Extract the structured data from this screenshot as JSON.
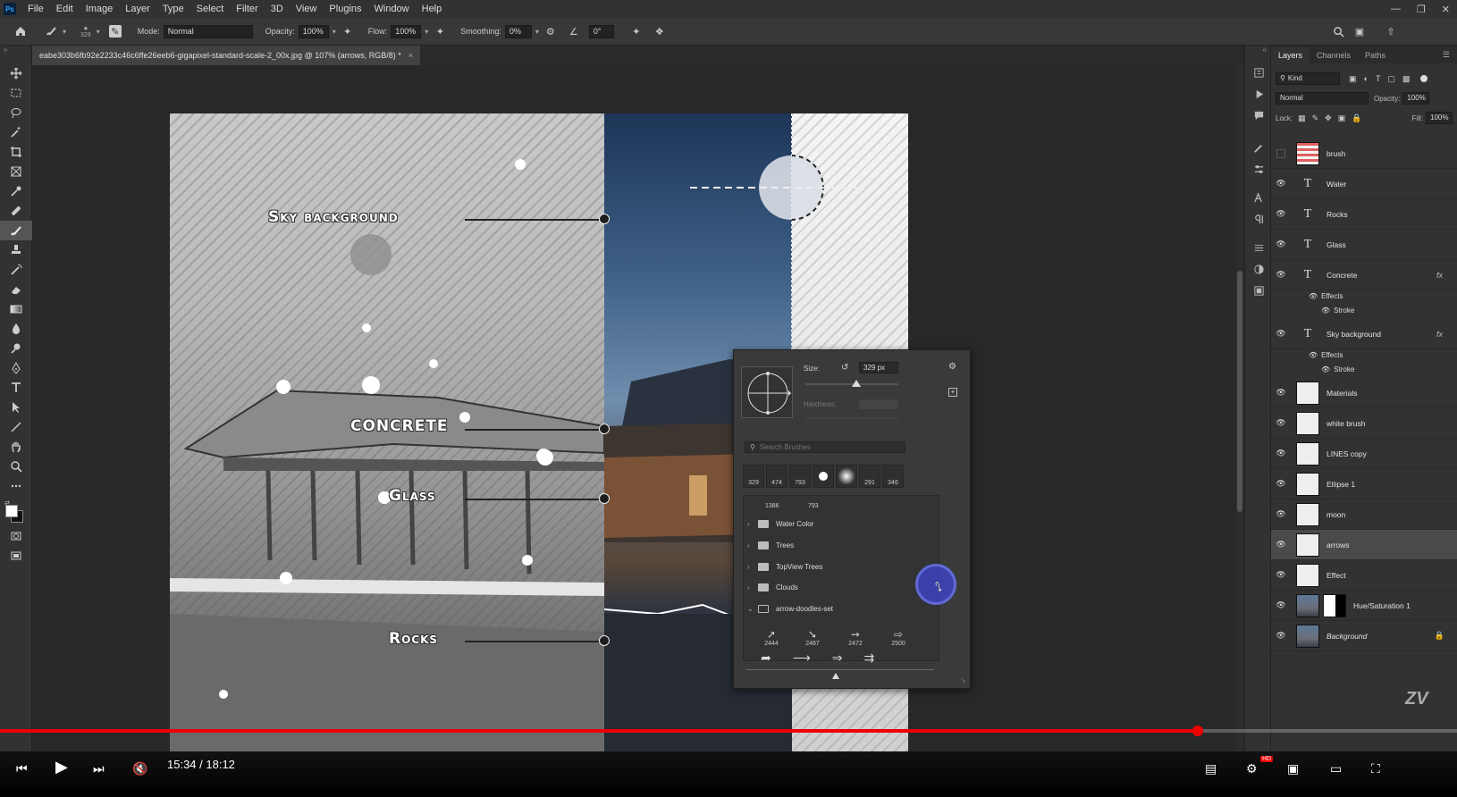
{
  "app": {
    "logo": "Ps"
  },
  "menu": [
    "File",
    "Edit",
    "Image",
    "Layer",
    "Type",
    "Select",
    "Filter",
    "3D",
    "View",
    "Plugins",
    "Window",
    "Help"
  ],
  "options_bar": {
    "brush_size": "329",
    "mode_label": "Mode:",
    "mode_value": "Normal",
    "opacity_label": "Opacity:",
    "opacity_value": "100%",
    "flow_label": "Flow:",
    "flow_value": "100%",
    "smoothing_label": "Smoothing:",
    "smoothing_value": "0%",
    "angle_value": "0°"
  },
  "document_tab": {
    "title": "eabe303b6fb92e2233c46c6ffe26eeb6-gigapixel-standard-scale-2_00x.jpg @ 107% (arrows, RGB/8) *",
    "close": "×"
  },
  "artwork": {
    "labels": [
      "Sky background",
      "Concrete",
      "Glass",
      "Rocks"
    ]
  },
  "brush_panel": {
    "size_label": "Size:",
    "size_value": "329 px",
    "size_slider_fraction": 0.55,
    "hardness_label": "Hardness:",
    "search_placeholder": "Search Brushes",
    "recent_presets": [
      "329",
      "474",
      "793",
      "",
      "",
      "291",
      "346"
    ],
    "partial_row": [
      "1386",
      "793"
    ],
    "folders": [
      {
        "name": "Water Color",
        "expanded": false
      },
      {
        "name": "Trees",
        "expanded": false
      },
      {
        "name": "TopView Trees",
        "expanded": false
      },
      {
        "name": "Clouds",
        "expanded": false
      },
      {
        "name": "arrow-doodles-set",
        "expanded": true
      }
    ],
    "arrow_brushes": [
      "2444",
      "2487",
      "2472",
      "2500"
    ]
  },
  "layers_panel": {
    "tabs": [
      "Layers",
      "Channels",
      "Paths"
    ],
    "filter_kind": "Kind",
    "blend_mode": "Normal",
    "opacity_label": "Opacity:",
    "opacity_value": "100%",
    "lock_label": "Lock:",
    "fill_label": "Fill:",
    "fill_value": "100%",
    "effects_label": "Effects",
    "stroke_label": "Stroke",
    "layers": [
      {
        "name": "brush",
        "kind": "pixel",
        "visible": false
      },
      {
        "name": "Water",
        "kind": "text",
        "visible": true
      },
      {
        "name": "Rocks",
        "kind": "text",
        "visible": true
      },
      {
        "name": "Glass",
        "kind": "text",
        "visible": true
      },
      {
        "name": "Concrete",
        "kind": "text",
        "visible": true,
        "fx": "fx"
      },
      {
        "name": "Sky background",
        "kind": "text",
        "visible": true,
        "fx": "fx"
      },
      {
        "name": "Materials",
        "kind": "pixel",
        "visible": true
      },
      {
        "name": "white brush",
        "kind": "pixel",
        "visible": true
      },
      {
        "name": "LINES copy",
        "kind": "pixel",
        "visible": true
      },
      {
        "name": "Ellipse 1",
        "kind": "pixel",
        "visible": true
      },
      {
        "name": "moon",
        "kind": "pixel",
        "visible": true
      },
      {
        "name": "arrows",
        "kind": "pixel",
        "visible": true,
        "selected": true
      },
      {
        "name": "Effect",
        "kind": "pixel",
        "visible": true
      },
      {
        "name": "Hue/Saturation 1",
        "kind": "adjustment",
        "visible": true
      },
      {
        "name": "Background",
        "kind": "image",
        "visible": true,
        "locked": true
      }
    ]
  },
  "video_player": {
    "time": "15:34 / 18:12",
    "progress_fraction": 0.857,
    "hd_badge": "HD",
    "watermark": "ZV"
  },
  "colors": {
    "accent": "#31a8ff",
    "progress": "#e00000",
    "panel": "#323232"
  }
}
